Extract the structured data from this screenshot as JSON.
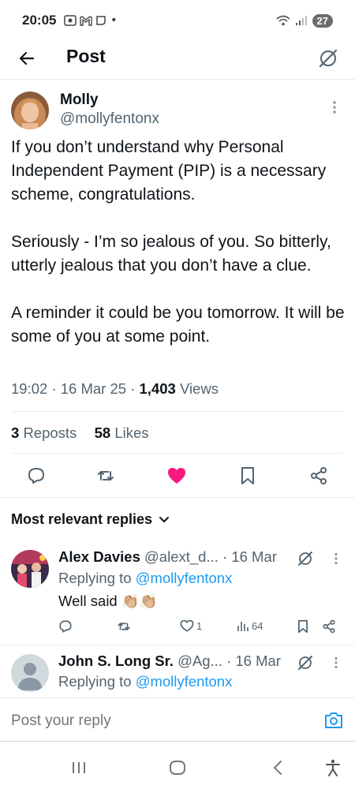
{
  "status_bar": {
    "time": "20:05",
    "battery": "27"
  },
  "header": {
    "title": "Post"
  },
  "post": {
    "author_name": "Molly",
    "author_handle": "@mollyfentonx",
    "paragraphs": [
      "If you don’t understand why Personal Independent Payment (PIP) is a necessary scheme, congratulations.",
      "Seriously - I’m so jealous of you. So bitterly, utterly jealous that you don’t have a clue.",
      "A reminder it could be you tomorrow. It will be some of you at some point."
    ],
    "time": "19:02",
    "date": "16 Mar 25",
    "views_count": "1,403",
    "views_label": "Views",
    "reposts_count": "3",
    "reposts_label": "Reposts",
    "likes_count": "58",
    "likes_label": "Likes",
    "liked": true
  },
  "replies_section": {
    "heading": "Most relevant replies"
  },
  "replies": [
    {
      "name": "Alex Davies",
      "handle": "@alext_d...",
      "date": "· 16 Mar",
      "replying_prefix": "Replying to",
      "replying_to": "@mollyfentonx",
      "text": "Well said 👏🏼👏🏼",
      "likes": "1",
      "views": "64"
    },
    {
      "name": "John S. Long Sr.",
      "handle": "@Ag...",
      "date": "· 16 Mar",
      "replying_prefix": "Replying to",
      "replying_to": "@mollyfentonx"
    }
  ],
  "composer": {
    "placeholder": "Post your reply"
  },
  "colors": {
    "accent": "#1d9bf0",
    "like": "#f91880",
    "text": "#0f1419",
    "secondary": "#536471"
  }
}
